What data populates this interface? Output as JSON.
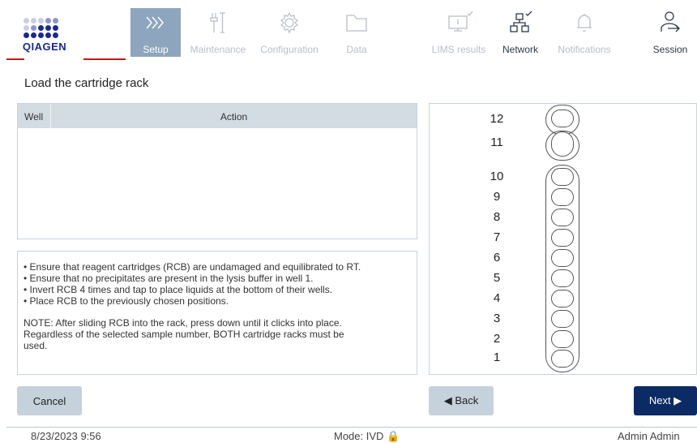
{
  "brand": {
    "name": "QIAGEN",
    "color": "#1a2a8c",
    "accent": "#c21a1a"
  },
  "nav": {
    "setup": {
      "label": "Setup",
      "icon": "chevrons-right-icon"
    },
    "maintenance": {
      "label": "Maintenance",
      "icon": "wrench-screwdriver-icon"
    },
    "configuration": {
      "label": "Configuration",
      "icon": "gear-icon"
    },
    "data": {
      "label": "Data",
      "icon": "folder-icon"
    },
    "lims": {
      "label": "LIMS results",
      "icon": "monitor-check-icon"
    },
    "network": {
      "label": "Network",
      "icon": "network-check-icon"
    },
    "notifications": {
      "label": "Notifications",
      "icon": "bell-icon"
    },
    "session": {
      "label": "Session",
      "icon": "user-logout-icon"
    }
  },
  "page": {
    "title": "Load the cartridge rack"
  },
  "table": {
    "columns": [
      "Well",
      "Action"
    ],
    "rows": []
  },
  "instructions": {
    "bullets": [
      "• Ensure that reagent cartridges (RCB) are undamaged and equilibrated to RT.",
      "• Ensure that no precipitates are present in the lysis buffer in well 1.",
      "• Invert RCB 4 times and tap to place liquids at the bottom of their wells.",
      "• Place RCB to the previously chosen positions."
    ],
    "note_lines": [
      "NOTE: After sliding RCB into the rack, press down until it clicks into place.",
      "Regardless of the selected sample number, BOTH cartridge racks must be",
      "used."
    ]
  },
  "rack": {
    "positions": [
      "12",
      "11",
      "10",
      "9",
      "8",
      "7",
      "6",
      "5",
      "4",
      "3",
      "2",
      "1"
    ]
  },
  "buttons": {
    "cancel": "Cancel",
    "back": "◀ Back",
    "next": "Next ▶"
  },
  "footer": {
    "datetime": "8/23/2023 9:56",
    "mode": "Mode: IVD 🔒",
    "user": "Admin Admin"
  },
  "colors": {
    "active_tab": "#8ea6bd",
    "primary_button": "#0c2a63",
    "secondary_button": "#c5d2dc",
    "table_header": "#d3dbe3"
  }
}
